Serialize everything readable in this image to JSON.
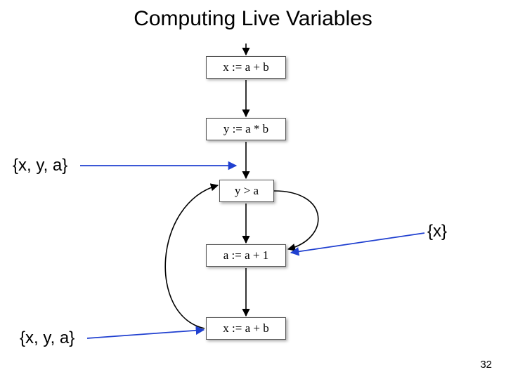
{
  "title": "Computing Live Variables",
  "nodes": {
    "n1": "x := a + b",
    "n2": "y := a * b",
    "n3": "y > a",
    "n4": "a := a + 1",
    "n5": "x := a + b"
  },
  "annotations": {
    "a1": "{x, y, a}",
    "a2": "{x}",
    "a3": "{x, y, a}"
  },
  "page_number": "32"
}
